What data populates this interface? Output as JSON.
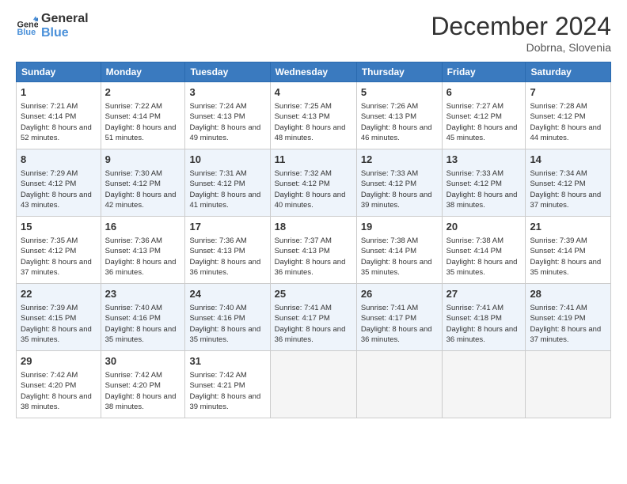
{
  "header": {
    "logo_general": "General",
    "logo_blue": "Blue",
    "title": "December 2024",
    "location": "Dobrna, Slovenia"
  },
  "weekdays": [
    "Sunday",
    "Monday",
    "Tuesday",
    "Wednesday",
    "Thursday",
    "Friday",
    "Saturday"
  ],
  "weeks": [
    [
      {
        "day": "1",
        "sunrise": "7:21 AM",
        "sunset": "4:14 PM",
        "daylight": "8 hours and 52 minutes."
      },
      {
        "day": "2",
        "sunrise": "7:22 AM",
        "sunset": "4:14 PM",
        "daylight": "8 hours and 51 minutes."
      },
      {
        "day": "3",
        "sunrise": "7:24 AM",
        "sunset": "4:13 PM",
        "daylight": "8 hours and 49 minutes."
      },
      {
        "day": "4",
        "sunrise": "7:25 AM",
        "sunset": "4:13 PM",
        "daylight": "8 hours and 48 minutes."
      },
      {
        "day": "5",
        "sunrise": "7:26 AM",
        "sunset": "4:13 PM",
        "daylight": "8 hours and 46 minutes."
      },
      {
        "day": "6",
        "sunrise": "7:27 AM",
        "sunset": "4:12 PM",
        "daylight": "8 hours and 45 minutes."
      },
      {
        "day": "7",
        "sunrise": "7:28 AM",
        "sunset": "4:12 PM",
        "daylight": "8 hours and 44 minutes."
      }
    ],
    [
      {
        "day": "8",
        "sunrise": "7:29 AM",
        "sunset": "4:12 PM",
        "daylight": "8 hours and 43 minutes."
      },
      {
        "day": "9",
        "sunrise": "7:30 AM",
        "sunset": "4:12 PM",
        "daylight": "8 hours and 42 minutes."
      },
      {
        "day": "10",
        "sunrise": "7:31 AM",
        "sunset": "4:12 PM",
        "daylight": "8 hours and 41 minutes."
      },
      {
        "day": "11",
        "sunrise": "7:32 AM",
        "sunset": "4:12 PM",
        "daylight": "8 hours and 40 minutes."
      },
      {
        "day": "12",
        "sunrise": "7:33 AM",
        "sunset": "4:12 PM",
        "daylight": "8 hours and 39 minutes."
      },
      {
        "day": "13",
        "sunrise": "7:33 AM",
        "sunset": "4:12 PM",
        "daylight": "8 hours and 38 minutes."
      },
      {
        "day": "14",
        "sunrise": "7:34 AM",
        "sunset": "4:12 PM",
        "daylight": "8 hours and 37 minutes."
      }
    ],
    [
      {
        "day": "15",
        "sunrise": "7:35 AM",
        "sunset": "4:12 PM",
        "daylight": "8 hours and 37 minutes."
      },
      {
        "day": "16",
        "sunrise": "7:36 AM",
        "sunset": "4:13 PM",
        "daylight": "8 hours and 36 minutes."
      },
      {
        "day": "17",
        "sunrise": "7:36 AM",
        "sunset": "4:13 PM",
        "daylight": "8 hours and 36 minutes."
      },
      {
        "day": "18",
        "sunrise": "7:37 AM",
        "sunset": "4:13 PM",
        "daylight": "8 hours and 36 minutes."
      },
      {
        "day": "19",
        "sunrise": "7:38 AM",
        "sunset": "4:14 PM",
        "daylight": "8 hours and 35 minutes."
      },
      {
        "day": "20",
        "sunrise": "7:38 AM",
        "sunset": "4:14 PM",
        "daylight": "8 hours and 35 minutes."
      },
      {
        "day": "21",
        "sunrise": "7:39 AM",
        "sunset": "4:14 PM",
        "daylight": "8 hours and 35 minutes."
      }
    ],
    [
      {
        "day": "22",
        "sunrise": "7:39 AM",
        "sunset": "4:15 PM",
        "daylight": "8 hours and 35 minutes."
      },
      {
        "day": "23",
        "sunrise": "7:40 AM",
        "sunset": "4:16 PM",
        "daylight": "8 hours and 35 minutes."
      },
      {
        "day": "24",
        "sunrise": "7:40 AM",
        "sunset": "4:16 PM",
        "daylight": "8 hours and 35 minutes."
      },
      {
        "day": "25",
        "sunrise": "7:41 AM",
        "sunset": "4:17 PM",
        "daylight": "8 hours and 36 minutes."
      },
      {
        "day": "26",
        "sunrise": "7:41 AM",
        "sunset": "4:17 PM",
        "daylight": "8 hours and 36 minutes."
      },
      {
        "day": "27",
        "sunrise": "7:41 AM",
        "sunset": "4:18 PM",
        "daylight": "8 hours and 36 minutes."
      },
      {
        "day": "28",
        "sunrise": "7:41 AM",
        "sunset": "4:19 PM",
        "daylight": "8 hours and 37 minutes."
      }
    ],
    [
      {
        "day": "29",
        "sunrise": "7:42 AM",
        "sunset": "4:20 PM",
        "daylight": "8 hours and 38 minutes."
      },
      {
        "day": "30",
        "sunrise": "7:42 AM",
        "sunset": "4:20 PM",
        "daylight": "8 hours and 38 minutes."
      },
      {
        "day": "31",
        "sunrise": "7:42 AM",
        "sunset": "4:21 PM",
        "daylight": "8 hours and 39 minutes."
      },
      null,
      null,
      null,
      null
    ]
  ],
  "labels": {
    "sunrise": "Sunrise:",
    "sunset": "Sunset:",
    "daylight": "Daylight:"
  }
}
